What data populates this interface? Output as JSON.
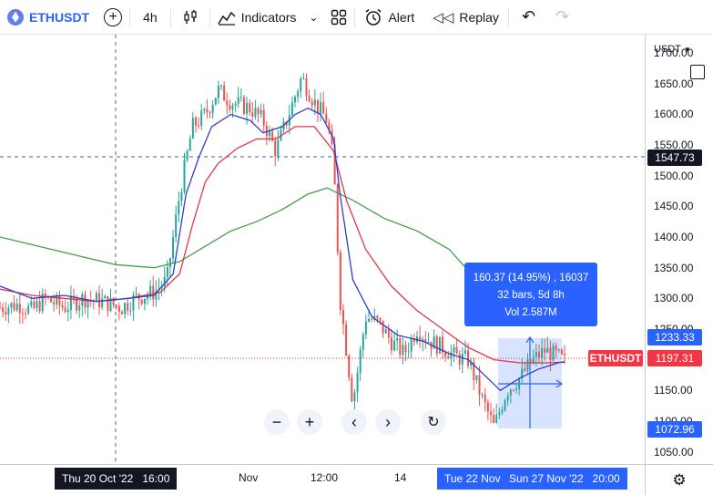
{
  "toolbar": {
    "symbol": "ETHUSDT",
    "interval": "4h",
    "indicators_label": "Indicators",
    "alert_label": "Alert",
    "replay_label": "Replay"
  },
  "price_axis": {
    "currency": "USDT",
    "ticks": [
      "1700.00",
      "1650.00",
      "1600.00",
      "1550.00",
      "1500.00",
      "1450.00",
      "1400.00",
      "1350.00",
      "1300.00",
      "1250.00",
      "1150.00",
      "1100.00",
      "1050.00"
    ],
    "crosshair_price": "1547.73",
    "range_high": "1233.33",
    "last_price": "1197.31",
    "range_low": "1072.96"
  },
  "time_axis": {
    "ticks": [
      "Nov",
      "12:00",
      "14"
    ],
    "crosshair_time": "Thu 20 Oct '22   16:00",
    "range_start": "Tue 22 Nov",
    "range_end": "Sun 27 Nov '22   20:00"
  },
  "measure": {
    "line1": "160.37 (14.95%) , 16037",
    "line2": "32 bars, 5d 8h",
    "line3": "Vol 2.587M"
  },
  "symbol_tag": "ETHUSDT",
  "colors": {
    "accent": "#2962ff",
    "up": "#26a69a",
    "down": "#ef5350",
    "ma_fast": "#2f3fc9",
    "ma_mid": "#e0364b",
    "ma_slow": "#43a047",
    "last_price": "#f23645"
  },
  "chart_data": {
    "type": "candlestick",
    "symbol": "ETHUSDT",
    "interval": "4h",
    "ylim": [
      1030,
      1730
    ],
    "close_path": [
      [
        0,
        1285
      ],
      [
        0.03,
        1290
      ],
      [
        0.05,
        1280
      ],
      [
        0.07,
        1300
      ],
      [
        0.1,
        1285
      ],
      [
        0.13,
        1300
      ],
      [
        0.16,
        1295
      ],
      [
        0.19,
        1285
      ],
      [
        0.21,
        1300
      ],
      [
        0.24,
        1310
      ],
      [
        0.26,
        1330
      ],
      [
        0.28,
        1470
      ],
      [
        0.3,
        1580
      ],
      [
        0.32,
        1600
      ],
      [
        0.34,
        1640
      ],
      [
        0.36,
        1620
      ],
      [
        0.39,
        1610
      ],
      [
        0.41,
        1590
      ],
      [
        0.43,
        1540
      ],
      [
        0.45,
        1600
      ],
      [
        0.47,
        1660
      ],
      [
        0.49,
        1620
      ],
      [
        0.51,
        1590
      ],
      [
        0.52,
        1520
      ],
      [
        0.53,
        1300
      ],
      [
        0.55,
        1130
      ],
      [
        0.57,
        1270
      ],
      [
        0.59,
        1260
      ],
      [
        0.61,
        1230
      ],
      [
        0.63,
        1210
      ],
      [
        0.65,
        1250
      ],
      [
        0.67,
        1230
      ],
      [
        0.69,
        1220
      ],
      [
        0.71,
        1205
      ],
      [
        0.73,
        1200
      ],
      [
        0.75,
        1140
      ],
      [
        0.77,
        1090
      ],
      [
        0.79,
        1150
      ],
      [
        0.81,
        1170
      ],
      [
        0.83,
        1200
      ],
      [
        0.85,
        1215
      ],
      [
        0.87,
        1205
      ],
      [
        0.88,
        1197
      ]
    ],
    "ma_fast_path": [
      [
        0,
        1320
      ],
      [
        0.05,
        1300
      ],
      [
        0.1,
        1305
      ],
      [
        0.15,
        1295
      ],
      [
        0.2,
        1300
      ],
      [
        0.24,
        1305
      ],
      [
        0.27,
        1340
      ],
      [
        0.29,
        1470
      ],
      [
        0.31,
        1530
      ],
      [
        0.33,
        1580
      ],
      [
        0.36,
        1600
      ],
      [
        0.39,
        1590
      ],
      [
        0.41,
        1570
      ],
      [
        0.44,
        1580
      ],
      [
        0.46,
        1600
      ],
      [
        0.48,
        1610
      ],
      [
        0.5,
        1600
      ],
      [
        0.52,
        1560
      ],
      [
        0.53,
        1470
      ],
      [
        0.55,
        1330
      ],
      [
        0.58,
        1270
      ],
      [
        0.62,
        1240
      ],
      [
        0.66,
        1230
      ],
      [
        0.7,
        1210
      ],
      [
        0.73,
        1200
      ],
      [
        0.76,
        1170
      ],
      [
        0.78,
        1150
      ],
      [
        0.81,
        1170
      ],
      [
        0.84,
        1185
      ],
      [
        0.87,
        1195
      ],
      [
        0.88,
        1197
      ]
    ],
    "ma_mid_path": [
      [
        0,
        1315
      ],
      [
        0.05,
        1305
      ],
      [
        0.1,
        1300
      ],
      [
        0.15,
        1295
      ],
      [
        0.2,
        1300
      ],
      [
        0.25,
        1310
      ],
      [
        0.28,
        1340
      ],
      [
        0.3,
        1420
      ],
      [
        0.32,
        1490
      ],
      [
        0.34,
        1520
      ],
      [
        0.37,
        1545
      ],
      [
        0.4,
        1560
      ],
      [
        0.43,
        1560
      ],
      [
        0.46,
        1580
      ],
      [
        0.49,
        1580
      ],
      [
        0.52,
        1540
      ],
      [
        0.54,
        1460
      ],
      [
        0.57,
        1380
      ],
      [
        0.61,
        1320
      ],
      [
        0.65,
        1280
      ],
      [
        0.69,
        1250
      ],
      [
        0.73,
        1220
      ],
      [
        0.77,
        1200
      ],
      [
        0.81,
        1195
      ],
      [
        0.85,
        1195
      ],
      [
        0.88,
        1196
      ]
    ],
    "ma_slow_path": [
      [
        0,
        1400
      ],
      [
        0.06,
        1385
      ],
      [
        0.12,
        1370
      ],
      [
        0.18,
        1355
      ],
      [
        0.24,
        1350
      ],
      [
        0.28,
        1360
      ],
      [
        0.32,
        1385
      ],
      [
        0.36,
        1410
      ],
      [
        0.4,
        1425
      ],
      [
        0.44,
        1445
      ],
      [
        0.48,
        1470
      ],
      [
        0.51,
        1480
      ],
      [
        0.55,
        1460
      ],
      [
        0.6,
        1430
      ],
      [
        0.65,
        1410
      ],
      [
        0.7,
        1380
      ],
      [
        0.73,
        1345
      ],
      [
        0.76,
        1325
      ]
    ]
  }
}
